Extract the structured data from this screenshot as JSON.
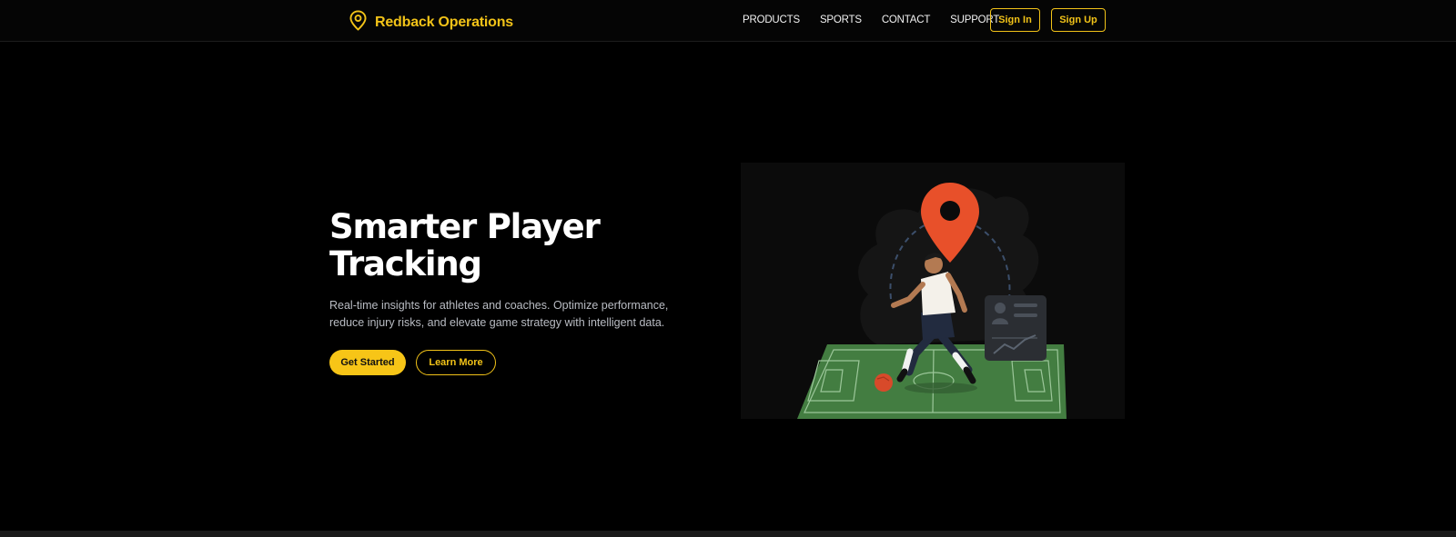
{
  "nav": {
    "brand": "Redback Operations",
    "links": [
      "PRODUCTS",
      "SPORTS",
      "CONTACT",
      "SUPPORT"
    ],
    "sign_in": "Sign In",
    "sign_up": "Sign Up"
  },
  "hero": {
    "title_line1": "Smarter Player",
    "title_line2": "Tracking",
    "subtitle": "Real-time insights for athletes and coaches. Optimize performance, reduce injury risks, and elevate game strategy with intelligent data.",
    "primary_cta": "Get Started",
    "secondary_cta": "Learn More"
  },
  "icons": {
    "brand_icon": "map-pin-icon",
    "illustration": "player-tracking-illustration"
  },
  "colors": {
    "accent": "#f2c318",
    "pin": "#e8502a",
    "pitch": "#3f7a3f",
    "background": "#000000"
  }
}
